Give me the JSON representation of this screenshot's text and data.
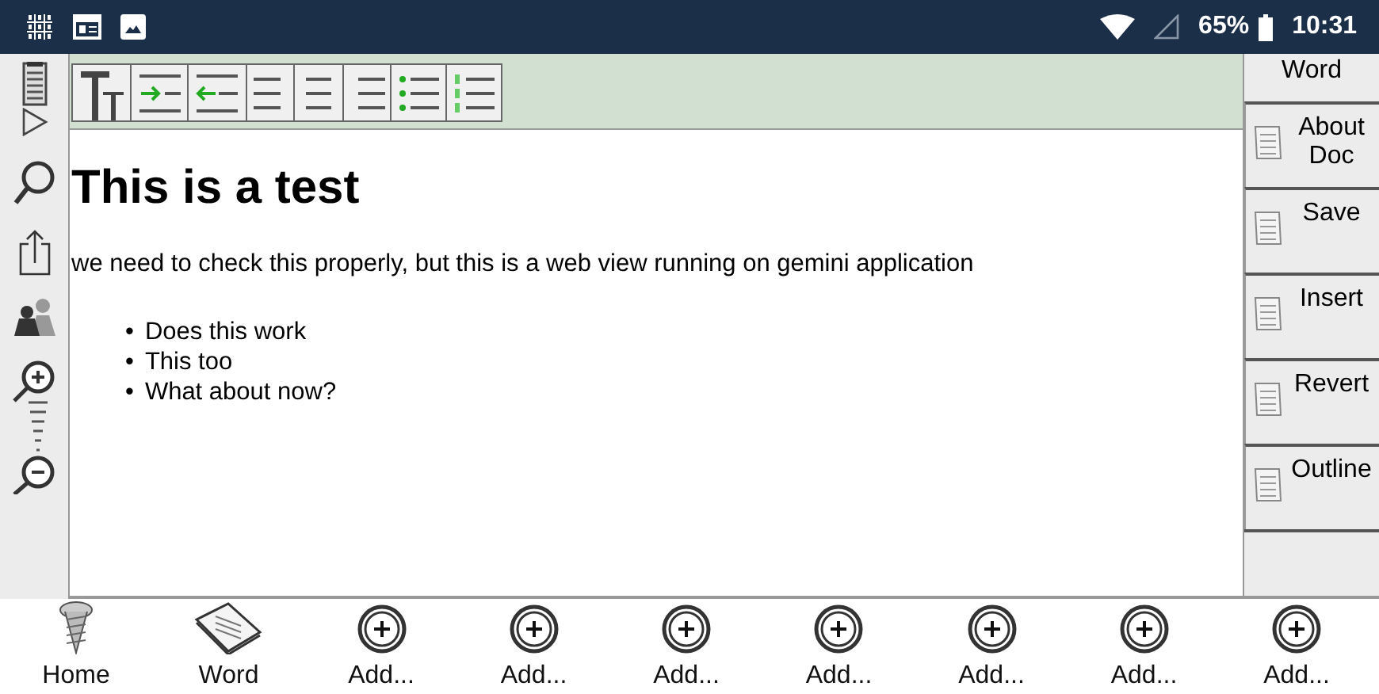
{
  "status_bar": {
    "battery": "65%",
    "time": "10:31"
  },
  "left_toolbar": [
    {
      "kind": "doc"
    },
    {
      "kind": "play"
    },
    {
      "kind": "search"
    },
    {
      "kind": "share"
    },
    {
      "kind": "people"
    },
    {
      "kind": "zoom"
    }
  ],
  "format_toolbar": [
    {
      "kind": "font-size"
    },
    {
      "kind": "indent"
    },
    {
      "kind": "outdent"
    },
    {
      "kind": "align-left"
    },
    {
      "kind": "align-center"
    },
    {
      "kind": "align-right"
    },
    {
      "kind": "bullets"
    },
    {
      "kind": "numbering"
    }
  ],
  "document": {
    "heading": "This is a test",
    "paragraph": "we need to check this properly, but this is a web view running on gemini application",
    "list": [
      {
        "marker": "•",
        "text": "Does this work"
      },
      {
        "marker": "•",
        "text": "This too"
      },
      {
        "marker": "•",
        "text": "What about now?"
      }
    ]
  },
  "side_panel": {
    "title": "Word",
    "buttons": [
      "About Doc",
      "Save",
      "Insert",
      "Revert",
      "Outline"
    ]
  },
  "bottom_nav": [
    {
      "kind": "home",
      "label": "Home"
    },
    {
      "kind": "word",
      "label": "Word"
    },
    {
      "kind": "add",
      "label": "Add..."
    },
    {
      "kind": "add",
      "label": "Add..."
    },
    {
      "kind": "add",
      "label": "Add..."
    },
    {
      "kind": "add",
      "label": "Add..."
    },
    {
      "kind": "add",
      "label": "Add..."
    },
    {
      "kind": "add",
      "label": "Add..."
    },
    {
      "kind": "add",
      "label": "Add..."
    }
  ]
}
